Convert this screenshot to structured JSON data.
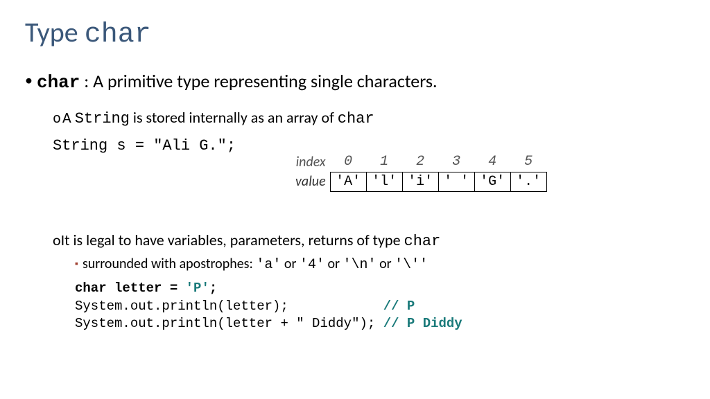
{
  "title": {
    "word1": "Type ",
    "word2": "char"
  },
  "bullet1": {
    "kw": "char",
    "rest": " : A primitive type representing single characters."
  },
  "sub1": {
    "prefix": "A ",
    "code1": "String",
    "mid": " is stored internally as an array of ",
    "code2": "char"
  },
  "code_decl": "String s = \"Ali G.\";",
  "table": {
    "index_label": "index",
    "value_label": "value",
    "indices": [
      "0",
      "1",
      "2",
      "3",
      "4",
      "5"
    ],
    "values": [
      "'A'",
      "'l'",
      "'i'",
      "' '",
      "'G'",
      "'.'"
    ]
  },
  "sub2": {
    "prefix": "It is legal to have variables, parameters, returns of type ",
    "code": "char"
  },
  "sq1": {
    "text": "surrounded with apostrophes:  ",
    "c1": "'a'",
    "or1": " or ",
    "c2": "'4'",
    "or2": "  or ",
    "c3": "'\\n'",
    "or3": " or ",
    "c4": "'\\''"
  },
  "codeblock": {
    "l1a": "char letter = ",
    "l1b": "'P'",
    "l1c": ";",
    "l2a": "System.out.println(letter);            ",
    "l2b": "// P",
    "l3a": "System.out.println(letter + \" Diddy\"); ",
    "l3b": "// P Diddy"
  }
}
